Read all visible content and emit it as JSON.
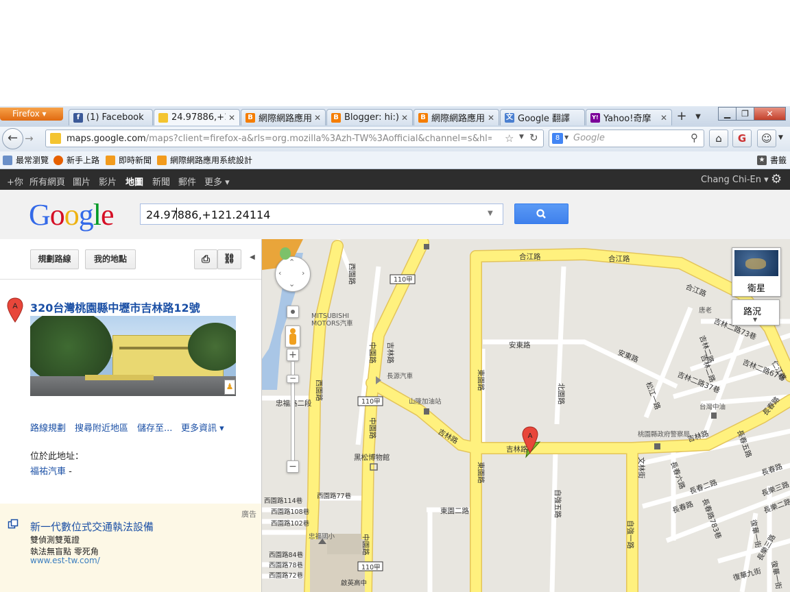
{
  "browser": {
    "menu_button": "Firefox ▾",
    "tabs": [
      {
        "title": "(1) Facebook",
        "icon": "facebook-icon",
        "color": "#3b5998",
        "glyph": "f"
      },
      {
        "title": "24.97886,+1...",
        "icon": "google-maps-icon",
        "color": "#e8b42c",
        "glyph": ""
      },
      {
        "title": "網際網路應用...",
        "icon": "blogger-icon",
        "color": "#f57d00",
        "glyph": "B"
      },
      {
        "title": "Blogger: hi:) ...",
        "icon": "blogger-icon",
        "color": "#f57d00",
        "glyph": "B"
      },
      {
        "title": "網際網路應用...",
        "icon": "blogger-icon",
        "color": "#f57d00",
        "glyph": "B"
      },
      {
        "title": "Google 翻譯",
        "icon": "translate-icon",
        "color": "#4a7fd0",
        "glyph": "文"
      },
      {
        "title": "Yahoo!奇摩",
        "icon": "yahoo-icon",
        "color": "#7b0099",
        "glyph": "Y!"
      }
    ],
    "new_tab": "+",
    "url_domain": "maps.google.com",
    "url_rest": "/maps?client=firefox-a&rls=org.mozilla%3Azh-TW%3Aofficial&channel=s&hl=zh-TW&source",
    "search_placeholder": "Google",
    "bookmarks": [
      {
        "label": "最常瀏覽",
        "icon": "most-visited-icon"
      },
      {
        "label": "新手上路",
        "icon": "firefox-icon"
      },
      {
        "label": "即時新聞",
        "icon": "rss-icon"
      },
      {
        "label": "網際網路應用系統設計",
        "icon": "rss-icon"
      }
    ],
    "bookmarks_menu": "書籤"
  },
  "gbar": {
    "items": [
      "+你",
      "所有網頁",
      "圖片",
      "影片",
      "地圖",
      "新聞",
      "郵件",
      "更多 ▾"
    ],
    "selected": "地圖",
    "user": "Chang Chi-En ▾"
  },
  "search": {
    "logo": "Google",
    "query": "24.97886,+121.24114"
  },
  "panel": {
    "directions_button": "規劃路線",
    "my_places_button": "我的地點",
    "marker_letter": "A",
    "address": "320台灣桃園縣中壢市吉林路12號",
    "links": [
      "路線規劃",
      "搜尋附近地區",
      "儲存至...",
      "更多資訊 ▾"
    ],
    "located_at": "位於此地址：",
    "place": "福祐汽車",
    "place_suffix": "-"
  },
  "ad": {
    "label": "廣告",
    "title": "新一代數位式交通執法設備",
    "line1": "雙偵測雙蒐證",
    "line2": "執法無盲點 零死角",
    "url": "www.est-tw.com/"
  },
  "map": {
    "satellite_label": "衛星",
    "traffic_label": "路況",
    "roads": [
      "合江路",
      "合江路",
      "合江路",
      "西園路",
      "110甲",
      "吉林路",
      "中園路",
      "安東路",
      "安東路",
      "東園路",
      "北園路",
      "吉林二路73巷",
      "吉林二路",
      "吉林二路67巷",
      "吉林二路37巷",
      "仁江路",
      "忠福路二段",
      "110甲",
      "長源汽車",
      "山隆加油站",
      "中園路",
      "西園路",
      "吉林路",
      "吉林路",
      "東園路",
      "自強五路",
      "桃園縣政府警察局",
      "吉林路",
      "長春五路",
      "長春路",
      "文林街",
      "長春六路",
      "長春二路",
      "長春路",
      "自強一路",
      "長春路",
      "長樂三路",
      "長樂二路",
      "長樂三路",
      "長春路783巷",
      "復華一街",
      "復華九街",
      "復華一街",
      "黑松博物館",
      "西園路114巷",
      "西園路108巷",
      "西園路102巷",
      "西園路77巷",
      "東園二路",
      "忠福國小",
      "西園路84巷",
      "西園路78巷",
      "西園路72巷",
      "中園路",
      "110甲",
      "啟英高中",
      "台灣中油",
      "MITSUBISHI",
      "MOTORS汽車",
      "唐老",
      "吉林二路",
      "松江一路"
    ]
  }
}
